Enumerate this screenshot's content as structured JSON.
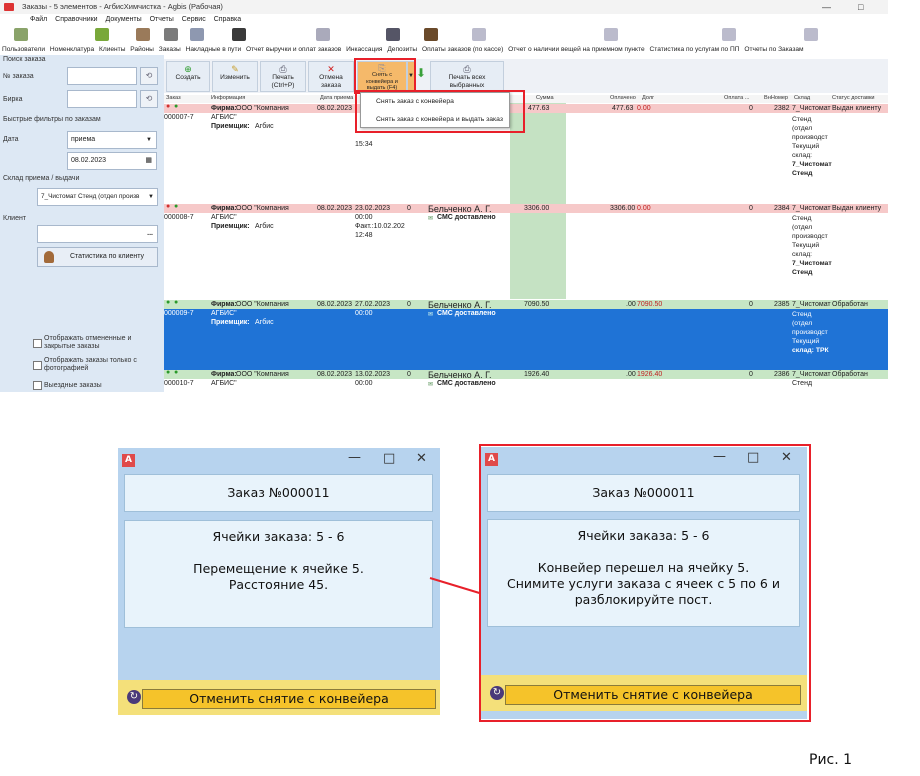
{
  "app": {
    "title": "Заказы - 5 элементов - АгбисХимчистка - Agbis (Рабочая)",
    "menu": [
      "Файл",
      "Справочники",
      "Документы",
      "Отчеты",
      "Сервис",
      "Справка"
    ],
    "nav": [
      "Пользователи",
      "Номенклатура",
      "Клиенты",
      "Районы",
      "Заказы",
      "Накладные в пути",
      "Отчет выручки и оплат заказов",
      "Инкассация",
      "Депозиты",
      "Оплаты заказов (по кассе)",
      "Отчет о наличии вещей на приемном пункте",
      "Статистика по услугам по ПП",
      "Отчеты по Заказам"
    ]
  },
  "left": {
    "search_header": "Поиск заказа",
    "order_no_label": "№ заказа",
    "tag_label": "Бирка",
    "quick_filters": "Быстрые фильтры по заказам",
    "date_label": "Дата",
    "date_type": "приема",
    "date_value": "08.02.2023",
    "warehouse_label": "Склад приема / выдачи",
    "warehouse_value": "7_Чистомат Стенд (отдел произв",
    "client_label": "Клиент",
    "client_dots": "...",
    "stats_button": "Статистика по клиенту",
    "chk1": "Отображать отмененные и закрытые заказы",
    "chk2": "Отображать заказы только с фотографией",
    "chk3": "Выездные заказы"
  },
  "toolbar": {
    "create": "Создать",
    "edit": "Изменить",
    "print": "Печать (Ctrl+P)",
    "cancel": "Отмена заказа",
    "remove_conveyor": "Снять с конвейера и выдать (F4)",
    "print_all": "Печать всех выбранных"
  },
  "dropdown": {
    "item1": "Снять заказ с конвейера",
    "item2": "Снять заказ с конвейера и выдать заказ"
  },
  "grid": {
    "headers": [
      "Заказ",
      "Информация",
      "Дата приема",
      "Сумма",
      "Оплачено",
      "Долг",
      "Оплата ...",
      "ВнНомер",
      "Склад",
      "Статус доставки"
    ],
    "rows": [
      {
        "order": "000007-7",
        "firm": "Фирма:",
        "company": "ООО \"Компания",
        "company2": "АГБИС\"",
        "receiver": "Приемщик:",
        "receiver_name": "Агбис",
        "date1": "08.02.2023",
        "date2": "",
        "zero": "",
        "client": "",
        "sms": "",
        "time": "15:34",
        "sum": "477.63",
        "paid": "477.63",
        "debt": "0.00",
        "pay": "0",
        "num": "2382",
        "store": "7_Чистомат",
        "status": "Выдан клиенту",
        "store_lines": [
          "Стенд",
          "(отдел",
          "производст",
          "Текущий",
          "склад:",
          "7_Чистомат",
          "Стенд"
        ]
      },
      {
        "order": "000008-7",
        "firm": "Фирма:",
        "company": "ООО \"Компания",
        "company2": "АГБИС\"",
        "receiver": "Приемщик:",
        "receiver_name": "Агбис",
        "date1": "08.02.2023",
        "date2": "23.02.2023",
        "zero": "0",
        "client": "Бельченко А. Г.",
        "sms": "СМС доставлено",
        "time": "00:00",
        "fact": "Факт.:10.02.202",
        "time2": "12:48",
        "sum": "3306.00",
        "paid": "3306.00",
        "debt": "0.00",
        "pay": "0",
        "num": "2384",
        "store": "7_Чистомат",
        "status": "Выдан клиенту",
        "store_lines": [
          "Стенд",
          "(отдел",
          "производст",
          "Текущий",
          "склад:",
          "7_Чистомат",
          "Стенд"
        ]
      },
      {
        "order": "000009-7",
        "firm": "Фирма:",
        "company": "ООО \"Компания",
        "company2": "АГБИС\"",
        "receiver": "Приемщик:",
        "receiver_name": "Агбис",
        "date1": "08.02.2023",
        "date2": "27.02.2023",
        "zero": "0",
        "client": "Бельченко А. Г.",
        "sms": "СМС доставлено",
        "time": "00:00",
        "sum": "7090.50",
        "paid": ".00",
        "debt": "7090.50",
        "pay": "0",
        "num": "2385",
        "store": "7_Чистомат",
        "status": "Обработан",
        "store_lines": [
          "Стенд",
          "(отдел",
          "производст",
          "Текущий",
          "склад: ТРК"
        ]
      },
      {
        "order": "000010-7",
        "firm": "Фирма:",
        "company": "ООО \"Компания",
        "company2": "АГБИС\"",
        "date1": "08.02.2023",
        "date2": "13.02.2023",
        "zero": "0",
        "client": "Бельченко А. Г.",
        "sms": "СМС доставлено",
        "time": "00:00",
        "sum": "1926.40",
        "paid": ".00",
        "debt": "1926.40",
        "pay": "0",
        "num": "2386",
        "store": "7_Чистомат",
        "status": "Обработан",
        "store_lines": [
          "Стенд"
        ]
      }
    ]
  },
  "dialog_left": {
    "order_title": "Заказ №000011",
    "cells": "Ячейки заказа: 5 - 6",
    "msg1": "Перемещение к ячейке 5.",
    "msg2": "Расстояние 45.",
    "cancel_btn": "Отменить снятие с конвейера"
  },
  "dialog_right": {
    "order_title": "Заказ №000011",
    "cells": "Ячейки заказа: 5 - 6",
    "msg1": "Конвейер перешел на ячейку 5.",
    "msg2": "Снимите услуги заказа с ячеек с 5 по 6 и",
    "msg3": "разблокируйте пост.",
    "cancel_btn": "Отменить снятие с конвейера"
  },
  "caption": "Рис. 1",
  "colors": {
    "pink_row": "#f6c9c9",
    "green_row": "#c7e6c5",
    "selected_row": "#1f73d6",
    "highlight_red": "#e8202a",
    "dialog_bg": "#b7d3ee",
    "button_yellow": "#f5c32a"
  }
}
